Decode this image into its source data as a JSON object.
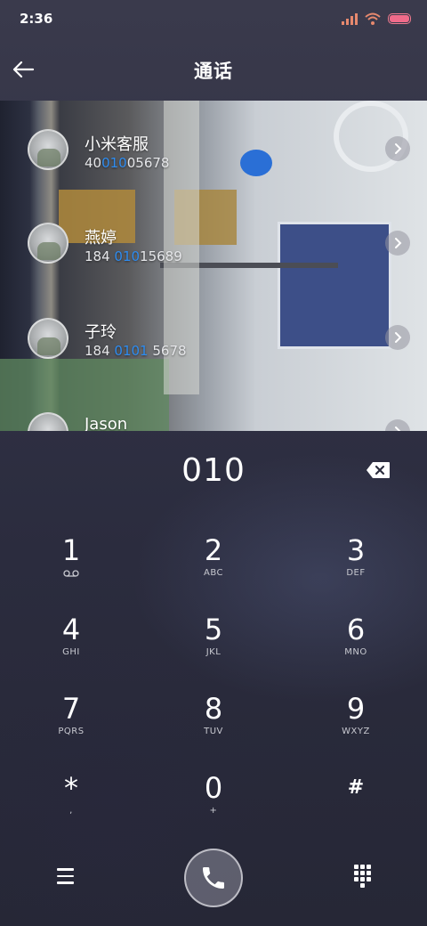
{
  "status": {
    "time": "2:36"
  },
  "header": {
    "title": "通话",
    "back_icon": "arrow-left-icon"
  },
  "results": [
    {
      "name": "小米客服",
      "number_pre": "40",
      "number_match": "010",
      "number_post": "05678"
    },
    {
      "name": "燕婷",
      "number_pre": "184 ",
      "number_match": "010",
      "number_post": "15689"
    },
    {
      "name": "子玲",
      "number_pre": "184 ",
      "number_match": "0101",
      "number_post": " 5678"
    },
    {
      "name": "Jason",
      "number_pre": "",
      "number_match": "",
      "number_post": ""
    }
  ],
  "dial": {
    "number": "010"
  },
  "keypad": [
    {
      "digit": "1",
      "letters": ""
    },
    {
      "digit": "2",
      "letters": "ABC"
    },
    {
      "digit": "3",
      "letters": "DEF"
    },
    {
      "digit": "4",
      "letters": "GHI"
    },
    {
      "digit": "5",
      "letters": "JKL"
    },
    {
      "digit": "6",
      "letters": "MNO"
    },
    {
      "digit": "7",
      "letters": "PQRS"
    },
    {
      "digit": "8",
      "letters": "TUV"
    },
    {
      "digit": "9",
      "letters": "WXYZ"
    },
    {
      "digit": "*",
      "letters": ","
    },
    {
      "digit": "0",
      "letters": "+"
    },
    {
      "digit": "#",
      "letters": ""
    }
  ],
  "colors": {
    "highlight": "#2e8cf0",
    "battery": "#f06b8a",
    "signal": "#e7896e"
  }
}
